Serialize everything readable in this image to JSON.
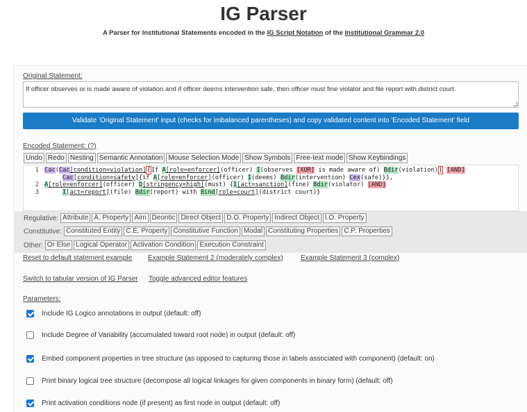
{
  "header": {
    "title": "IG Parser",
    "subtitle_1": "A Parser for Institutional Statements encoded in the ",
    "subtitle_link_1": "IG Script Notation",
    "subtitle_2": " of the ",
    "subtitle_link_2": "Institutional Grammar 2.0"
  },
  "original": {
    "label": "Original Statement:",
    "value": "If officer observes or is made aware of violation and if officer deems intervention safe, then officer must fine violator and file report with district court."
  },
  "validate_button": "Validate 'Original Statement' input (checks for imbalanced parentheses) and copy validated content into 'Encoded Statement' field",
  "encoded": {
    "label": "Encoded Statement: (?)",
    "toolbar": [
      "Undo",
      "Redo",
      "Nesting",
      "Semantic Annotation",
      "Mouse Selection Mode",
      "Show Symbols",
      "Free-text mode",
      "Show Keybindings"
    ],
    "line_numbers": [
      "1",
      "",
      "2",
      "3"
    ]
  },
  "categories": {
    "regulative_label": "Regulative:",
    "regulative": [
      "Attribute",
      "A. Property",
      "Aim",
      "Deontic",
      "Direct Object",
      "D.O. Property",
      "Indirect Object",
      "I.O. Property"
    ],
    "constitutive_label": "Constitutive:",
    "constitutive": [
      "Constituted Entity",
      "C.E. Property",
      "Constitutive Function",
      "Modal",
      "Constituting Properties",
      "C.P. Properties"
    ],
    "other_label": "Other:",
    "other": [
      "Or Else",
      "Logical Operator",
      "Activation Condition",
      "Execution Constraint"
    ]
  },
  "links": {
    "reset": "Reset to default statement example",
    "example2": "Example Statement 2 (moderately complex)",
    "example3": "Example Statement 3 (complex)",
    "tabular": "Switch to tabular version of IG Parser",
    "advanced": "Toggle advanced editor features"
  },
  "parameters": {
    "label": "Parameters:",
    "items": [
      {
        "label": "Include IG Logico annotations in output (default: off)",
        "checked": true
      },
      {
        "label": "Include Degree of Variability (accumulated toward root node) in output (default: off)",
        "checked": false
      },
      {
        "label": "Embed component properties in tree structure (as opposed to capturing those in labels associated with component) (default: on)",
        "checked": true
      },
      {
        "label": "Print binary logical tree structure (decompose all logical linkages for given components in binary form) (default: off)",
        "checked": false
      },
      {
        "label": "Print activation conditions node (if present) as first node in output (default: off)",
        "checked": true
      }
    ]
  },
  "colors": {
    "accent": "#1a7bc7",
    "checkbox": "#1a73d8",
    "purple_highlight": "#cdb6f2",
    "green_highlight": "#a8e6c2",
    "red_highlight": "#f4a3ad"
  }
}
